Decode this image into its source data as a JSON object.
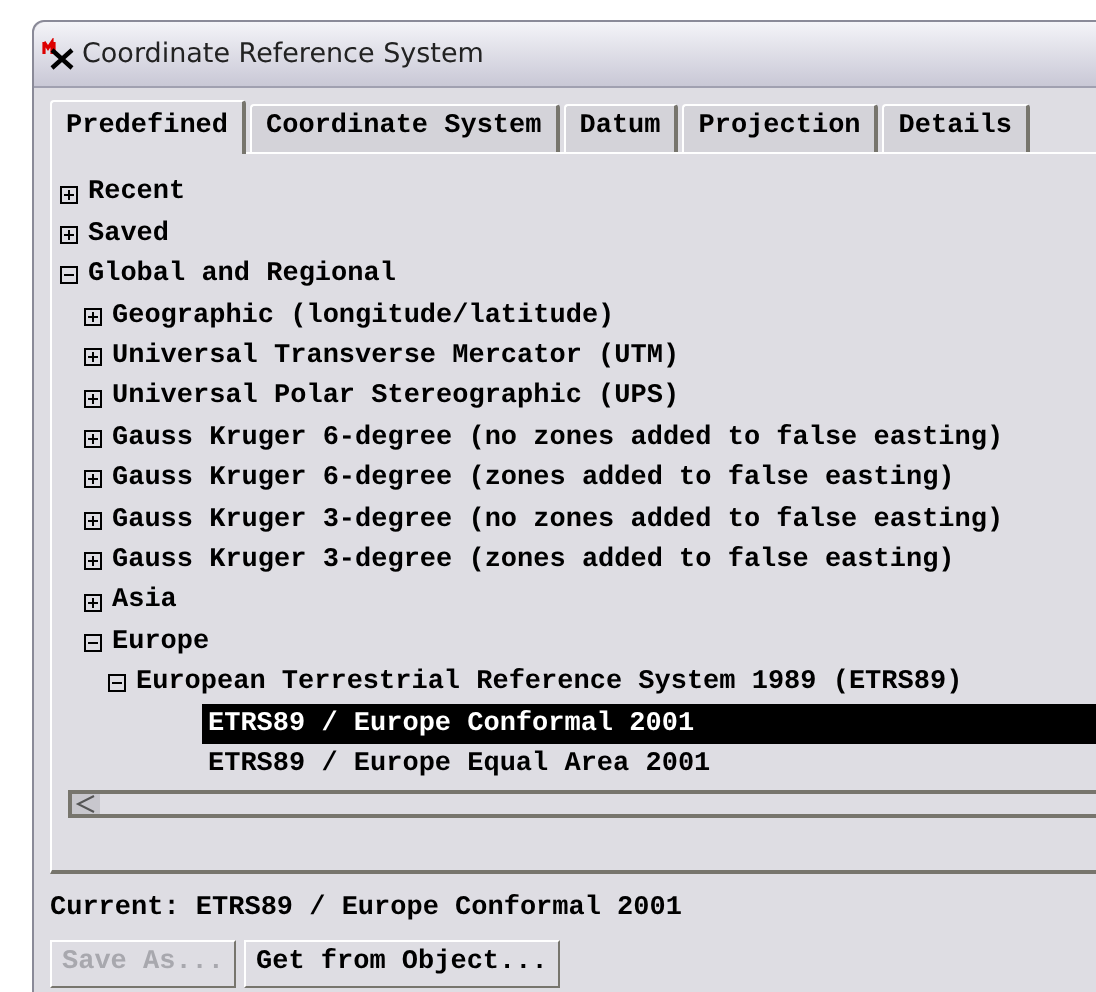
{
  "window": {
    "title": "Coordinate Reference System"
  },
  "tabs": [
    {
      "label": "Predefined",
      "selected": true
    },
    {
      "label": "Coordinate System",
      "selected": false
    },
    {
      "label": "Datum",
      "selected": false
    },
    {
      "label": "Projection",
      "selected": false
    },
    {
      "label": "Details",
      "selected": false
    }
  ],
  "tree": [
    {
      "label": "Recent",
      "expanded": false
    },
    {
      "label": "Saved",
      "expanded": false
    },
    {
      "label": "Global and Regional",
      "expanded": true,
      "children": [
        {
          "label": "Geographic (longitude/latitude)",
          "expanded": false
        },
        {
          "label": "Universal Transverse Mercator (UTM)",
          "expanded": false
        },
        {
          "label": "Universal Polar Stereographic (UPS)",
          "expanded": false
        },
        {
          "label": "Gauss Kruger 6-degree (no zones added to false easting)",
          "expanded": false
        },
        {
          "label": "Gauss Kruger 6-degree (zones added to false easting)",
          "expanded": false
        },
        {
          "label": "Gauss Kruger 3-degree (no zones added to false easting)",
          "expanded": false
        },
        {
          "label": "Gauss Kruger 3-degree (zones added to false easting)",
          "expanded": false
        },
        {
          "label": "Asia",
          "expanded": false
        },
        {
          "label": "Europe",
          "expanded": true,
          "children": [
            {
              "label": "European Terrestrial Reference System 1989 (ETRS89)",
              "expanded": true,
              "children": [
                {
                  "label": "ETRS89 / Europe Conformal 2001",
                  "selected": true
                },
                {
                  "label": "ETRS89 / Europe Equal Area 2001",
                  "selected": false
                }
              ]
            }
          ]
        }
      ]
    }
  ],
  "current": "Current: ETRS89 / Europe Conformal 2001",
  "buttons": [
    {
      "label": "Save As...",
      "disabled": true
    },
    {
      "label": "Get from Object...",
      "disabled": false
    }
  ]
}
